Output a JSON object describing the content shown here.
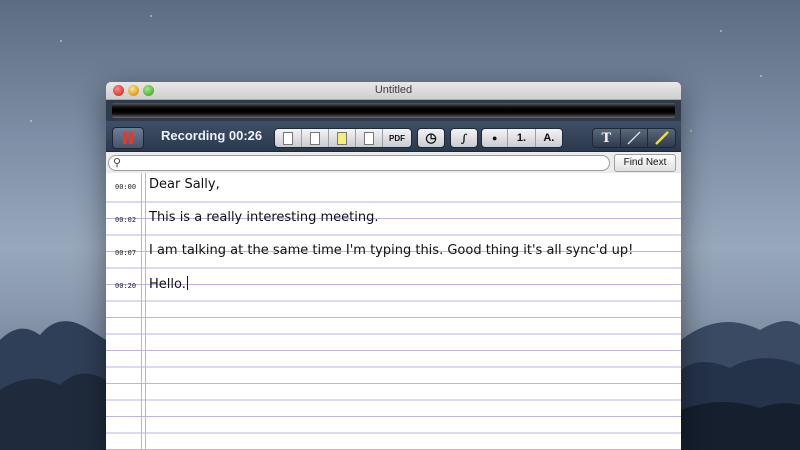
{
  "window": {
    "title": "Untitled"
  },
  "toolbar": {
    "record_button": "pause",
    "recording_label": "Recording 00:26",
    "pdf_label": "PDF",
    "integral_label": "∫",
    "bullet_label": "●",
    "numbered_label": "1.",
    "lettered_label": "A.",
    "text_tool_label": "T"
  },
  "search": {
    "placeholder": "",
    "find_next_label": "Find Next"
  },
  "notes": [
    {
      "time": "00:00",
      "text": "Dear Sally,"
    },
    {
      "time": "00:02",
      "text": "This is a really interesting meeting."
    },
    {
      "time": "00:07",
      "text": "I am talking at the same time I'm typing this.  Good thing it's all sync'd up!"
    },
    {
      "time": "00:20",
      "text": "Hello."
    }
  ],
  "colors": {
    "toolbar": "#34435a",
    "record_red": "#e23a2a",
    "rule_line": "#b9b6e6",
    "margin_line": "#f0a0a8"
  }
}
